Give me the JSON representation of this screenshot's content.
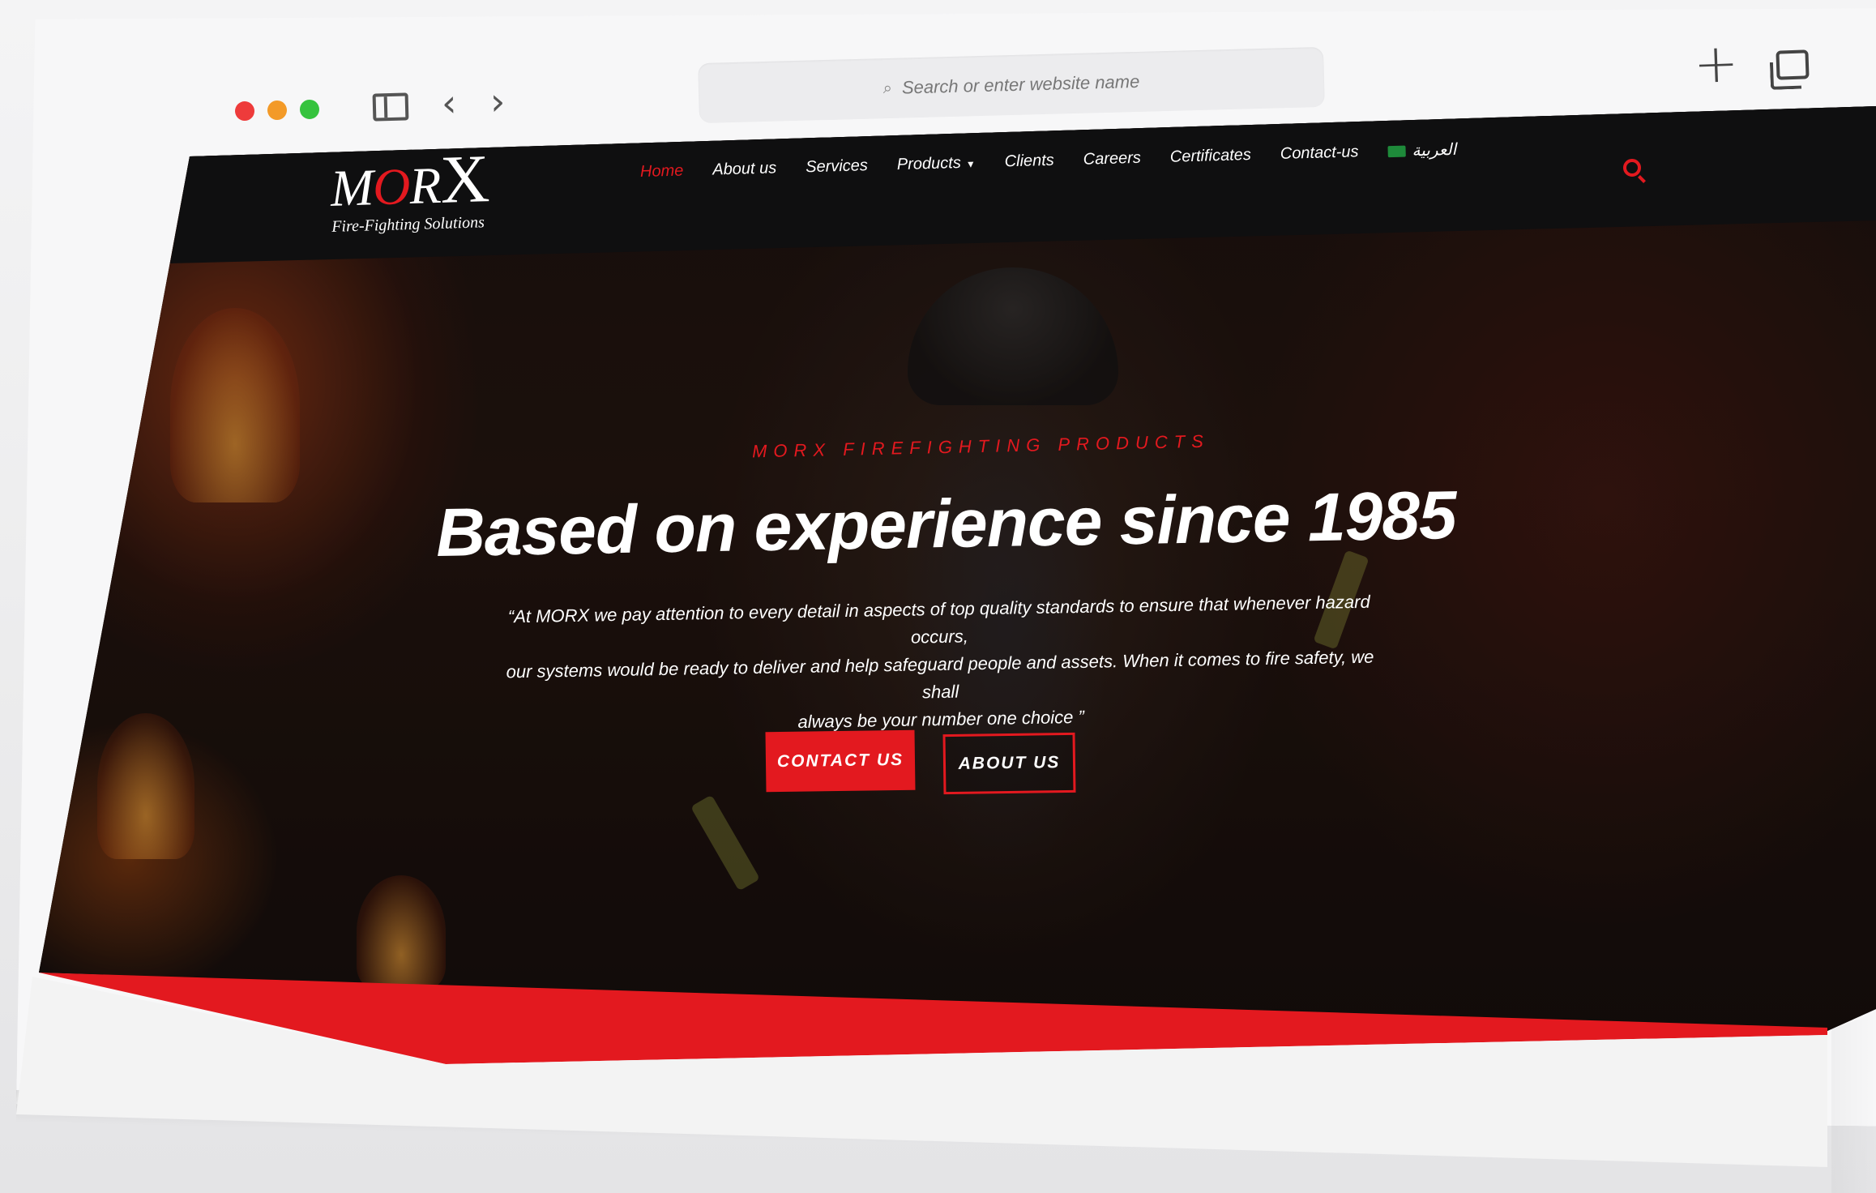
{
  "browser": {
    "address_placeholder": "Search or enter website name",
    "icons": [
      "sidebar-icon",
      "back-icon",
      "forward-icon",
      "search-icon",
      "new-tab-icon",
      "tabs-overview-icon"
    ]
  },
  "site": {
    "logo": {
      "mark_parts": [
        "M",
        "O",
        "R",
        "X"
      ],
      "subtitle": "Fire-Fighting Solutions"
    },
    "nav": {
      "items": [
        {
          "label": "Home",
          "active": true
        },
        {
          "label": "About us",
          "active": false
        },
        {
          "label": "Services",
          "active": false
        },
        {
          "label": "Products",
          "active": false,
          "dropdown": true
        },
        {
          "label": "Clients",
          "active": false
        },
        {
          "label": "Careers",
          "active": false
        },
        {
          "label": "Certificates",
          "active": false
        },
        {
          "label": "Contact-us",
          "active": false
        }
      ],
      "language": "العربية"
    },
    "hero": {
      "kicker": "MORX FIREFIGHTING PRODUCTS",
      "title": "Based on experience since 1985",
      "quote_lines": [
        "“At MORX we pay attention to every detail in aspects of top quality standards to ensure that whenever hazard occurs,",
        "our systems would be ready to deliver and help safeguard people and assets. When it comes to fire safety, we shall",
        "always be your number one choice ”"
      ],
      "primary_button": "CONTACT US",
      "secondary_button": "ABOUT US"
    }
  },
  "colors": {
    "accent": "#e3191f",
    "nav_bg": "#0f0f10",
    "text_light": "#ffffff"
  }
}
